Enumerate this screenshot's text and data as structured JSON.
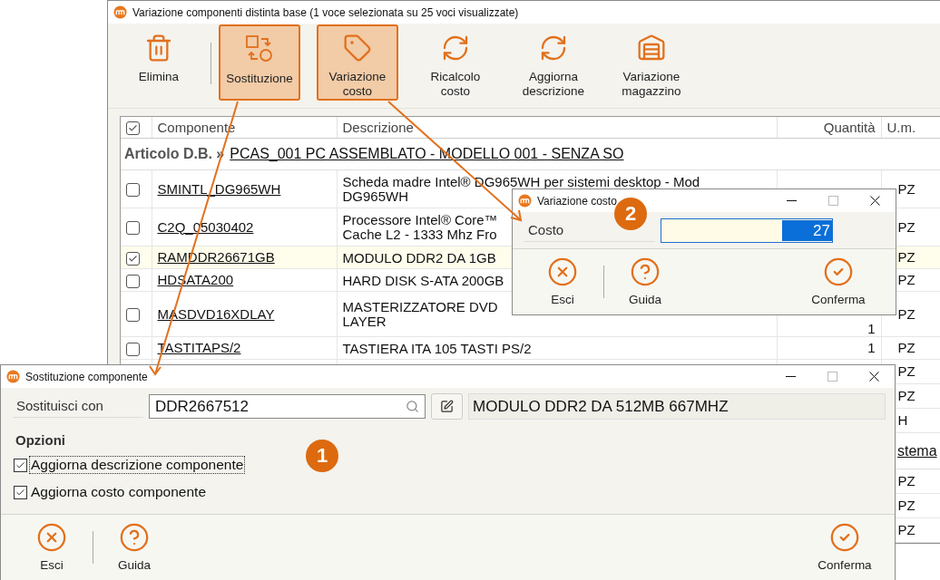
{
  "main_window": {
    "title": "Variazione componenti distinta base (1 voce selezionata su 25 voci visualizzate)",
    "toolbar": [
      {
        "label": "Elimina",
        "kind": "trash",
        "selected": false
      },
      {
        "label": "Sostituzione",
        "kind": "swap",
        "selected": true
      },
      {
        "label": "Variazione costo",
        "kind": "tag",
        "selected": true
      },
      {
        "label": "Ricalcolo costo",
        "kind": "refresh",
        "selected": false
      },
      {
        "label": "Aggiorna descrizione",
        "kind": "refresh",
        "selected": false
      },
      {
        "label": "Variazione magazzino",
        "kind": "warehouse",
        "selected": false
      }
    ],
    "table": {
      "all_checked": true,
      "columns": [
        {
          "label": "Componente"
        },
        {
          "label": "Descrizione"
        },
        {
          "label": "Quantità"
        },
        {
          "label": "U.m."
        }
      ],
      "rows": [
        {
          "kind": "group",
          "label": "Articolo D.B. »",
          "link": "PCAS_001 PC ASSEMBLATO - MODELLO 001 - SENZA SO"
        },
        {
          "kind": "item",
          "checked": false,
          "component": "SMINTL_DG965WH",
          "description": [
            "Scheda madre Intel® DG965WH per sistemi desktop - Mod",
            "DG965WH"
          ],
          "unit": "PZ"
        },
        {
          "kind": "item",
          "checked": false,
          "component": "C2Q_05030402",
          "description": [
            "Processore Intel® Core™",
            "Cache L2 - 1333 Mhz Fro"
          ],
          "unit": "PZ"
        },
        {
          "kind": "item",
          "checked": true,
          "component": "RAMDDR26671GB",
          "description": [
            "MODULO DDR2 DA 1GB"
          ],
          "unit": "PZ"
        },
        {
          "kind": "item",
          "checked": false,
          "component": "HDSATA200",
          "description": [
            "HARD DISK S-ATA 200GB"
          ],
          "unit": "PZ"
        },
        {
          "kind": "item",
          "checked": false,
          "component": "MASDVD16XDLAY",
          "description": [
            "MASTERIZZATORE DVD",
            "LAYER"
          ],
          "quantity": "1",
          "unit": "PZ"
        },
        {
          "kind": "item",
          "checked": false,
          "component": "TASTITAPS/2",
          "description": [
            "TASTIERA ITA 105 TASTI PS/2"
          ],
          "quantity": "1",
          "unit": "PZ"
        },
        {
          "kind": "item",
          "unit": "PZ"
        },
        {
          "kind": "item",
          "unit": "PZ"
        },
        {
          "kind": "item",
          "unit": "H"
        },
        {
          "kind": "group",
          "link": "stema"
        },
        {
          "kind": "item",
          "unit": "PZ"
        },
        {
          "kind": "item",
          "unit": "PZ"
        },
        {
          "kind": "item",
          "unit": "PZ"
        }
      ]
    }
  },
  "cost_dialog": {
    "title": "Variazione costo",
    "badge": "2",
    "field_label": "Costo",
    "value": "27",
    "value_selected": true,
    "buttons": [
      {
        "label": "Esci",
        "kind": "close"
      },
      {
        "label": "Guida",
        "kind": "help"
      },
      {
        "label": "Conferma",
        "kind": "confirm"
      }
    ]
  },
  "replace_dialog": {
    "title": "Sostituzione componente",
    "badge": "1",
    "field_label": "Sostituisci con",
    "value": "DDR2667512",
    "description": "MODULO DDR2 DA 512MB 667MHZ",
    "options_title": "Opzioni",
    "options": [
      {
        "label": "Aggiorna descrizione componente",
        "checked": true,
        "focused": true
      },
      {
        "label": "Aggiorna costo componente",
        "checked": true,
        "focused": false
      }
    ],
    "buttons": [
      {
        "label": "Esci",
        "kind": "close"
      },
      {
        "label": "Guida",
        "kind": "help"
      },
      {
        "label": "Conferma",
        "kind": "confirm"
      }
    ]
  }
}
